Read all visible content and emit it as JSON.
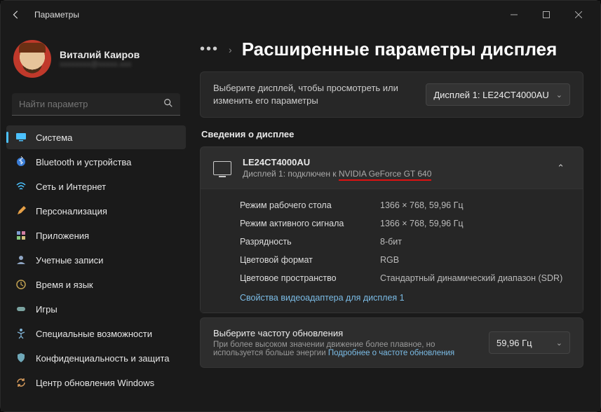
{
  "window": {
    "title": "Параметры"
  },
  "profile": {
    "name": "Виталий Каиров",
    "email": "xxxxxxxx@xxxxx.xxx"
  },
  "search": {
    "placeholder": "Найти параметр"
  },
  "nav": [
    {
      "label": "Система"
    },
    {
      "label": "Bluetooth и устройства"
    },
    {
      "label": "Сеть и Интернет"
    },
    {
      "label": "Персонализация"
    },
    {
      "label": "Приложения"
    },
    {
      "label": "Учетные записи"
    },
    {
      "label": "Время и язык"
    },
    {
      "label": "Игры"
    },
    {
      "label": "Специальные возможности"
    },
    {
      "label": "Конфиденциальность и защита"
    },
    {
      "label": "Центр обновления Windows"
    }
  ],
  "breadcrumb": {
    "title": "Расширенные параметры дисплея"
  },
  "selectDisplay": {
    "help": "Выберите дисплей, чтобы просмотреть или изменить его параметры",
    "value": "Дисплей 1: LE24CT4000AU"
  },
  "sectionTitle": "Сведения о дисплее",
  "displayBlock": {
    "name": "LE24CT4000AU",
    "sub_pre": "Дисплей 1: подключен к ",
    "sub_gpu": "NVIDIA GeForce GT 640",
    "rows": [
      {
        "k": "Режим рабочего стола",
        "v": "1366 × 768, 59,96 Гц"
      },
      {
        "k": "Режим активного сигнала",
        "v": "1366 × 768, 59,96 Гц"
      },
      {
        "k": "Разрядность",
        "v": "8-бит"
      },
      {
        "k": "Цветовой формат",
        "v": "RGB"
      },
      {
        "k": "Цветовое пространство",
        "v": "Стандартный динамический диапазон (SDR)"
      }
    ],
    "link": "Свойства видеоадаптера для дисплея 1"
  },
  "refresh": {
    "title": "Выберите частоту обновления",
    "sub": "При более высоком значении движение более плавное, но используется больше энергии ",
    "more": "Подробнее о частоте обновления",
    "value": "59,96 Гц"
  },
  "icons": {
    "system": "sys",
    "bt": "bt",
    "net": "net",
    "pers": "pers",
    "apps": "apps",
    "acct": "acct",
    "time": "time",
    "game": "game",
    "acc": "acc",
    "priv": "priv",
    "upd": "upd"
  }
}
